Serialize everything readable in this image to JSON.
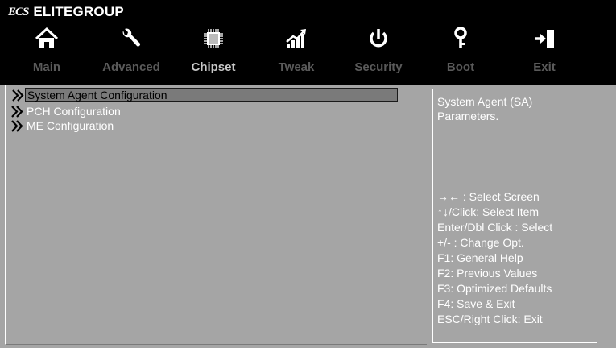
{
  "brand": {
    "logo": "ECS",
    "name": "ELITEGROUP"
  },
  "tabs": [
    {
      "label": "Main",
      "icon": "home-icon",
      "active": false
    },
    {
      "label": "Advanced",
      "icon": "wrench-icon",
      "active": false
    },
    {
      "label": "Chipset",
      "icon": "chip-icon",
      "active": true
    },
    {
      "label": "Tweak",
      "icon": "chart-icon",
      "active": false
    },
    {
      "label": "Security",
      "icon": "power-icon",
      "active": false
    },
    {
      "label": "Boot",
      "icon": "key-icon",
      "active": false
    },
    {
      "label": "Exit",
      "icon": "exit-icon",
      "active": false
    }
  ],
  "menu": [
    {
      "label": "System Agent Configuration",
      "selected": true
    },
    {
      "label": "PCH Configuration",
      "selected": false
    },
    {
      "label": "ME Configuration",
      "selected": false
    }
  ],
  "help": {
    "description_line1": "System Agent (SA)",
    "description_line2": "Parameters.",
    "keys": [
      "→←  : Select Screen",
      "↑↓/Click: Select Item",
      "Enter/Dbl Click : Select",
      "+/- : Change Opt.",
      "F1: General Help",
      "F2: Previous Values",
      "F3: Optimized Defaults",
      "F4: Save & Exit",
      "ESC/Right Click: Exit"
    ]
  },
  "colors": {
    "background": "#a5a5a5",
    "topbar": "#000000",
    "tab_inactive": "#5a5a5a",
    "tab_active": "#c8c8c8"
  }
}
